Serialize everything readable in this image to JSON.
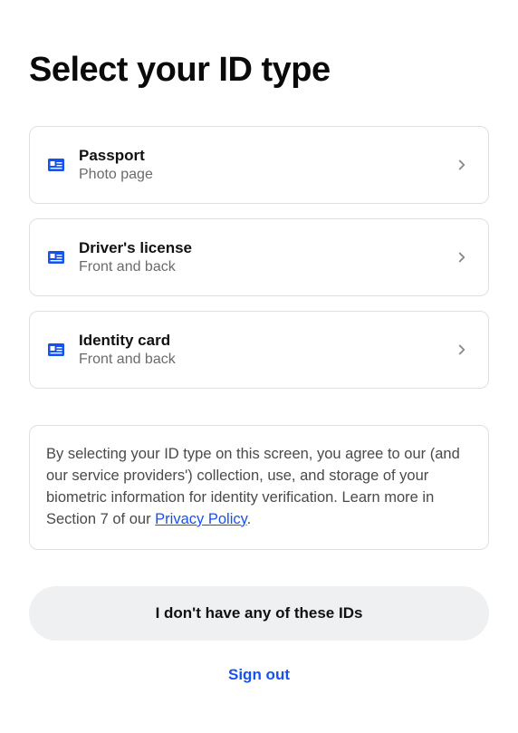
{
  "title": "Select your ID type",
  "options": [
    {
      "title": "Passport",
      "subtitle": "Photo page"
    },
    {
      "title": "Driver's license",
      "subtitle": "Front and back"
    },
    {
      "title": "Identity card",
      "subtitle": "Front and back"
    }
  ],
  "disclosure": {
    "text_before_link": "By selecting your ID type on this screen, you agree to our (and our service providers') collection, use, and storage of your biometric information for identity verification. Learn more in Section 7 of our ",
    "link_text": "Privacy Policy",
    "text_after_link": "."
  },
  "no_id_button": "I don't have any of these IDs",
  "sign_out": "Sign out",
  "colors": {
    "accent": "#1652f0",
    "border": "#e0e0e0",
    "muted": "#6b6b6b"
  }
}
